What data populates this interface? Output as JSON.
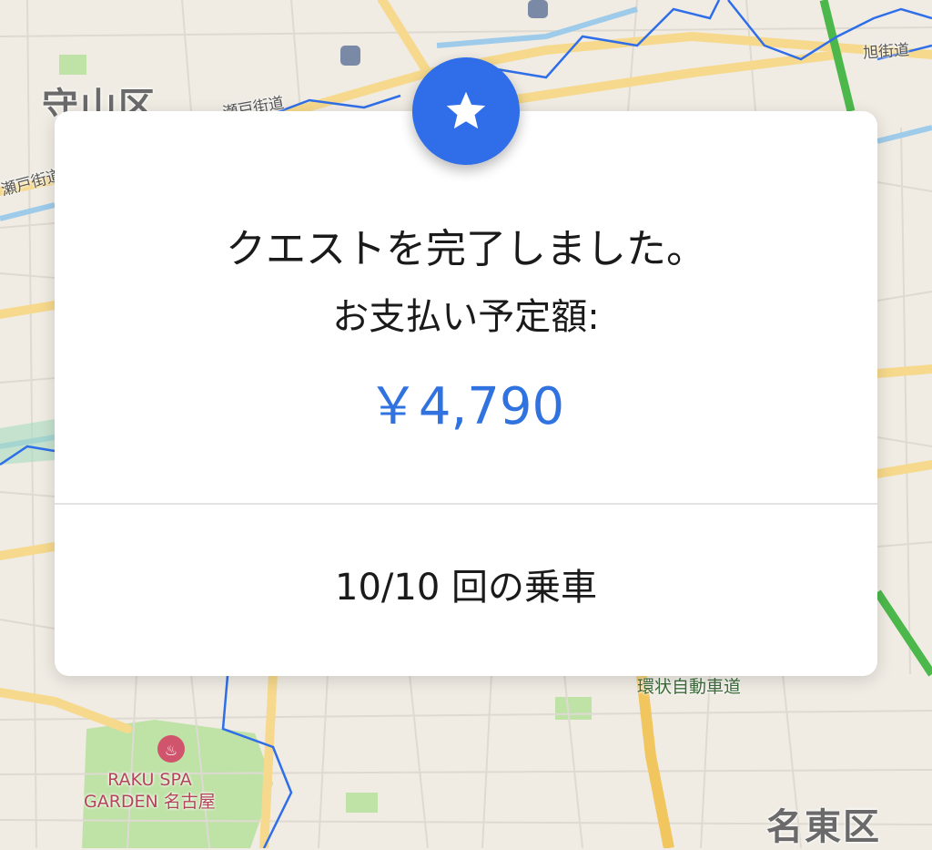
{
  "map": {
    "area_labels": [
      "守山区",
      "名東区"
    ],
    "road_labels": [
      "旭街道",
      "瀬戸街道",
      "瀬戸街道"
    ],
    "expressway_label": "環状自動車道",
    "poi": {
      "name_line1": "RAKU SPA",
      "name_line2": "GARDEN 名古屋",
      "icon": "hot-spring-icon"
    },
    "colors": {
      "background": "#f0ece4",
      "major_road": "#f6d98c",
      "expressway": "#4cb84c",
      "river": "#9ecbea",
      "boundary": "#2f6ee8",
      "park": "#bfe2a7"
    }
  },
  "dialog": {
    "badge_icon": "star-icon",
    "title": "クエストを完了しました。",
    "subtitle": "お支払い予定額:",
    "amount": "￥4,790",
    "rides_progress": "10/10 回の乗車",
    "colors": {
      "badge": "#2f6ee8",
      "amount": "#2f72e0"
    }
  }
}
